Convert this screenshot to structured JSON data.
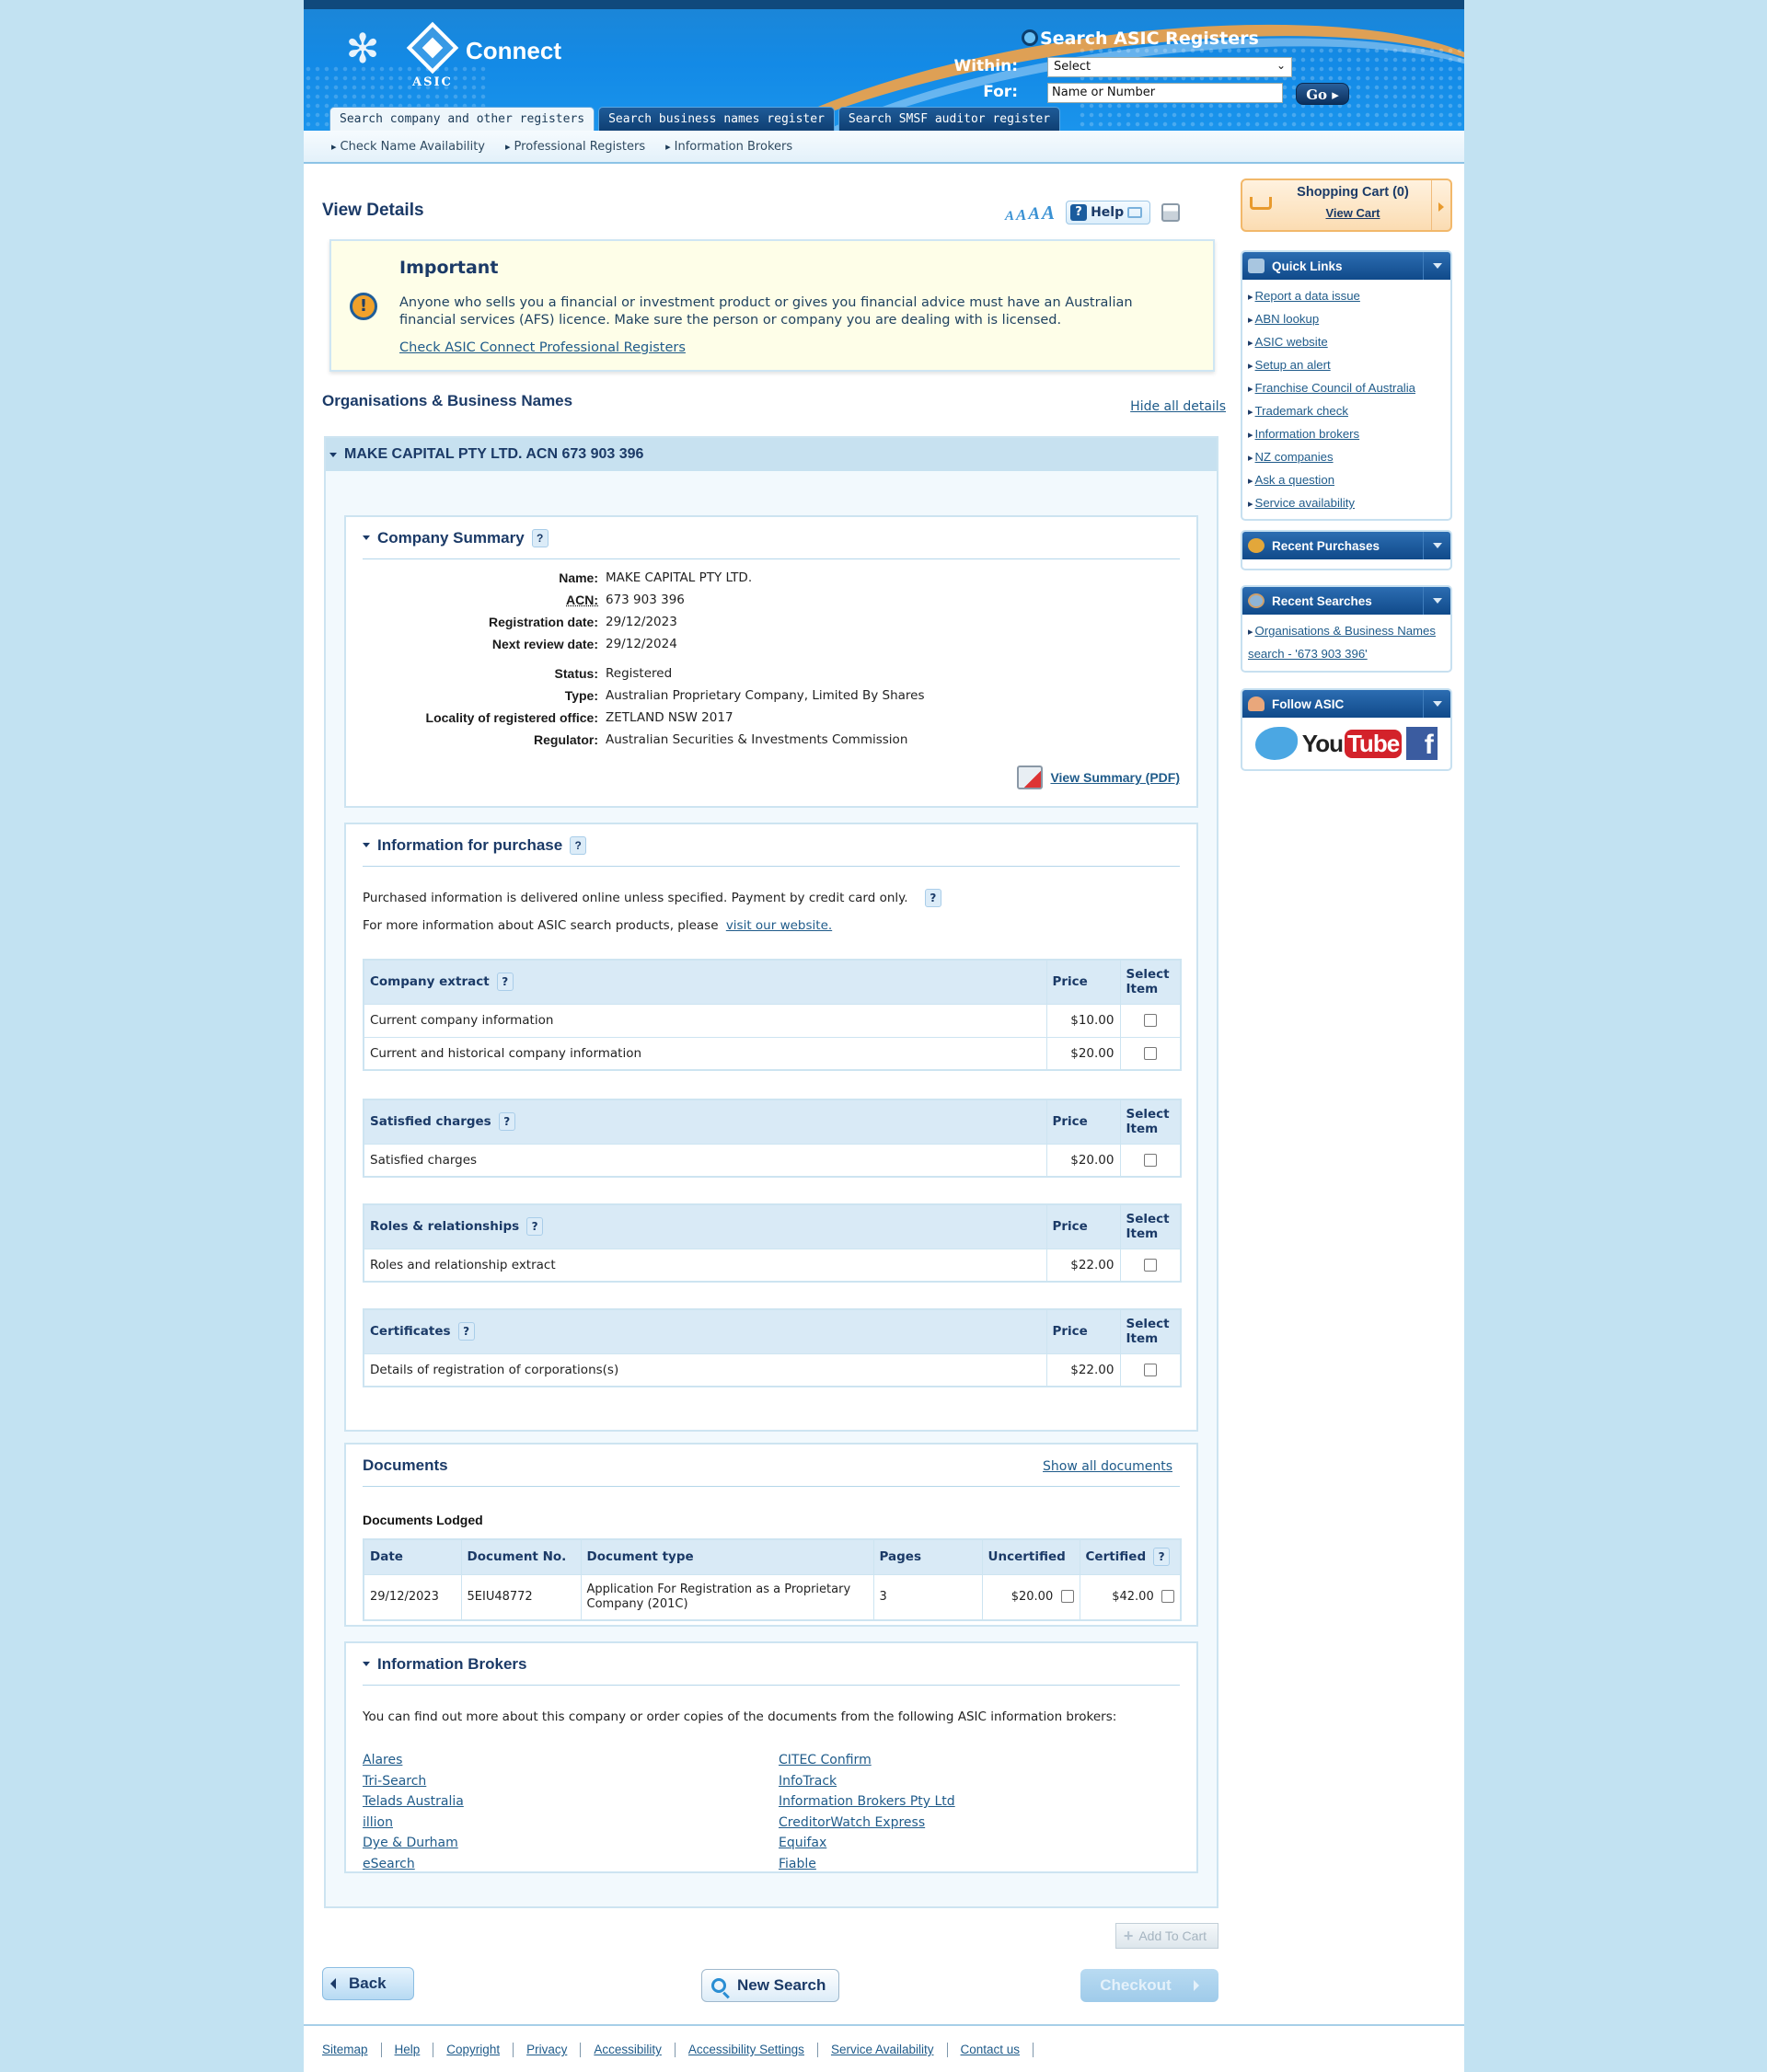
{
  "header": {
    "brand": "Connect",
    "org": "ASIC",
    "search_title": "Search ASIC Registers",
    "within_label": "Within:",
    "within_value": "Select",
    "for_label": "For:",
    "for_value": "Name or Number",
    "go_label": "Go",
    "tabs": [
      {
        "label": "Search company and other registers",
        "active": true
      },
      {
        "label": "Search business names register",
        "active": false
      },
      {
        "label": "Search SMSF auditor register",
        "active": false
      }
    ],
    "subnav": [
      "Check Name Availability",
      "Professional Registers",
      "Information Brokers"
    ]
  },
  "main": {
    "title": "View Details",
    "help_label": "Help",
    "font_size_labels": [
      "A",
      "A",
      "A",
      "A"
    ],
    "important": {
      "title": "Important",
      "text": "Anyone who sells you a financial or investment product or gives you financial advice must have an Australian financial services (AFS) licence. Make sure the person or company you are dealing with is licensed.",
      "link": "Check ASIC Connect Professional Registers"
    },
    "section_title": "Organisations & Business Names",
    "hide_all": "Hide all details",
    "entity_title": "MAKE CAPITAL PTY LTD. ACN 673 903 396",
    "summary": {
      "title": "Company Summary",
      "rows": [
        {
          "label": "Name:",
          "value": "MAKE CAPITAL PTY LTD."
        },
        {
          "label": "ACN:",
          "value": "673 903 396"
        },
        {
          "label": "Registration date:",
          "value": "29/12/2023"
        },
        {
          "label": "Next review date:",
          "value": "29/12/2024"
        },
        {
          "label": "Status:",
          "value": "Registered"
        },
        {
          "label": "Type:",
          "value": "Australian Proprietary Company, Limited By Shares"
        },
        {
          "label": "Locality of registered office:",
          "value": "ZETLAND NSW 2017"
        },
        {
          "label": "Regulator:",
          "value": "Australian Securities & Investments Commission"
        }
      ],
      "pdf_link": "View Summary (PDF)"
    },
    "purchase": {
      "title": "Information for purchase",
      "line1": "Purchased information is delivered online unless specified. Payment by credit card only.",
      "line2_prefix": "For more information about ASIC search products, please",
      "line2_link": "visit our website.",
      "price_header": "Price",
      "select_header": "Select Item",
      "tables": [
        {
          "title": "Company extract",
          "rows": [
            {
              "item": "Current company information",
              "price": "$10.00"
            },
            {
              "item": "Current and historical company information",
              "price": "$20.00"
            }
          ]
        },
        {
          "title": "Satisfied charges",
          "rows": [
            {
              "item": "Satisfied charges",
              "price": "$20.00"
            }
          ]
        },
        {
          "title": "Roles & relationships",
          "rows": [
            {
              "item": "Roles and relationship extract",
              "price": "$22.00"
            }
          ]
        },
        {
          "title": "Certificates",
          "rows": [
            {
              "item": "Details of registration of corporations(s)",
              "price": "$22.00"
            }
          ]
        }
      ]
    },
    "documents": {
      "title": "Documents",
      "show_all": "Show all documents",
      "lodged_title": "Documents Lodged",
      "headers": [
        "Date",
        "Document No.",
        "Document type",
        "Pages",
        "Uncertified",
        "Certified"
      ],
      "rows": [
        {
          "date": "29/12/2023",
          "doc_no": "5EIU48772",
          "type": "Application For Registration as a Proprietary Company (201C)",
          "pages": "3",
          "uncertified": "$20.00",
          "certified": "$42.00"
        }
      ]
    },
    "brokers": {
      "title": "Information Brokers",
      "text": "You can find out more about this company or order copies of the documents from the following ASIC information brokers:",
      "left": [
        "Alares",
        "Tri-Search",
        "Telads Australia",
        "illion",
        "Dye & Durham",
        "eSearch"
      ],
      "right": [
        "CITEC Confirm",
        "InfoTrack",
        "Information Brokers Pty Ltd",
        "CreditorWatch Express",
        "Equifax",
        "Fiable"
      ]
    },
    "buttons": {
      "add_to_cart": "Add To Cart",
      "back": "Back",
      "new_search": "New Search",
      "checkout": "Checkout"
    }
  },
  "sidebar": {
    "cart": {
      "title": "Shopping Cart (0)",
      "link": "View Cart"
    },
    "quick_links": {
      "title": "Quick Links",
      "items": [
        "Report a data issue",
        "ABN lookup",
        "ASIC website",
        "Setup an alert",
        "Franchise Council of Australia",
        "Trademark check",
        "Information brokers",
        "NZ companies",
        "Ask a question",
        "Service availability"
      ]
    },
    "recent_purchases": {
      "title": "Recent Purchases"
    },
    "recent_searches": {
      "title": "Recent Searches",
      "items": [
        "Organisations & Business Names search - '673 903 396'"
      ]
    },
    "follow": {
      "title": "Follow ASIC",
      "youtube_you": "You",
      "youtube_tube": "Tube",
      "facebook": "f"
    }
  },
  "footer": {
    "links": [
      "Sitemap",
      "Help",
      "Copyright",
      "Privacy",
      "Accessibility",
      "Accessibility Settings",
      "Service Availability",
      "Contact us"
    ]
  },
  "colors": {
    "page_bg": "#c2e2f2",
    "header_blue": "#1b86d8",
    "navy": "#1b3a67",
    "link": "#1f5b8a",
    "warning_bg": "#fefee8",
    "accent_orange": "#e89a2d"
  }
}
